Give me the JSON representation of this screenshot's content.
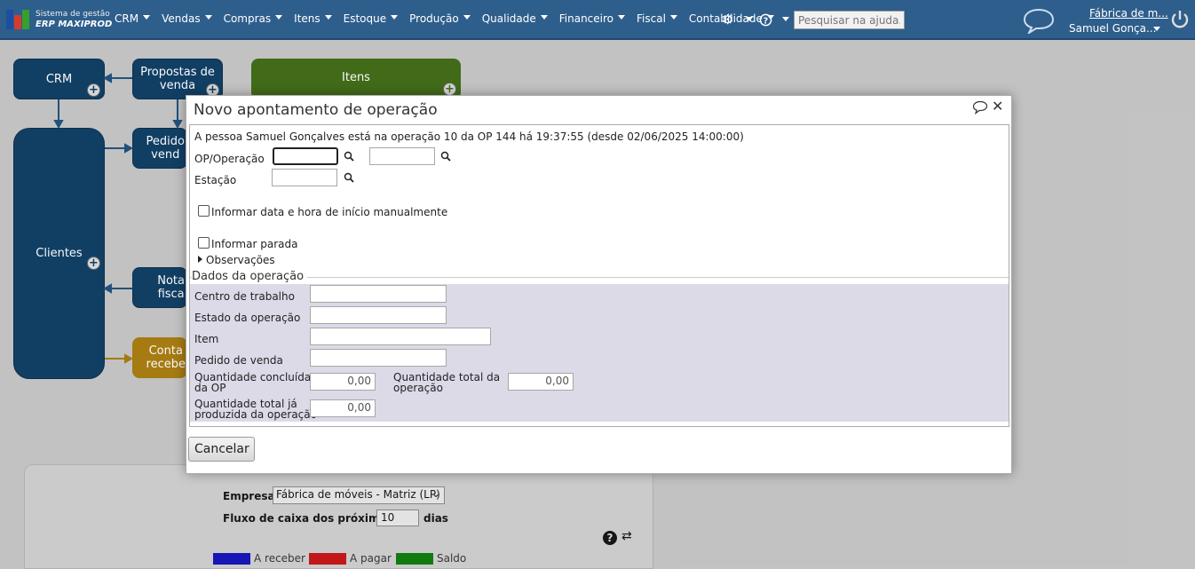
{
  "header": {
    "logo_line1": "Sistema de gestão",
    "logo_line2": "ERP MAXIPROD",
    "menu": [
      "CRM",
      "Vendas",
      "Compras",
      "Itens",
      "Estoque",
      "Produção",
      "Qualidade",
      "Financeiro",
      "Fiscal",
      "Contabilidade"
    ],
    "help_placeholder": "Pesquisar na ajuda...",
    "company": "Fábrica de m...",
    "user": "Samuel Gonça..."
  },
  "flow": {
    "crm": "CRM",
    "propostas": "Propostas de venda",
    "itens": "Itens",
    "pedidos": "Pedido\nvend",
    "clientes": "Clientes",
    "notas": "Nota\nfisca",
    "contas": "Conta\nrecebe"
  },
  "cashflow": {
    "empresa_label": "Empresa",
    "empresa_value": "Fábrica de móveis - Matriz (LP)",
    "fluxo_label": "Fluxo de caixa dos próximos",
    "fluxo_value": "10",
    "fluxo_unit": "dias",
    "legend": [
      {
        "label": "A receber",
        "color": "#1010b8"
      },
      {
        "label": "A pagar",
        "color": "#c41414"
      },
      {
        "label": "Saldo",
        "color": "#0b7a0b"
      }
    ]
  },
  "modal": {
    "title": "Novo apontamento de operação",
    "info": "A pessoa Samuel Gonçalves está na operação 10 da OP 144 há 19:37:55 (desde 02/06/2025 14:00:00)",
    "op_label": "OP/Operação",
    "estacao_label": "Estação",
    "manual_label": "Informar data e hora de início manualmente",
    "parada_label": "Informar parada",
    "obs_label": "Observações",
    "section_title": "Dados da operação",
    "centro_label": "Centro de trabalho",
    "estado_label": "Estado da operação",
    "item_label": "Item",
    "pedido_label": "Pedido de venda",
    "qtd_concluida_label_1": "Quantidade concluída",
    "qtd_concluida_label_2": "da OP",
    "qtd_concluida_value": "0,00",
    "qtd_total_label_1": "Quantidade total da",
    "qtd_total_label_2": "operação",
    "qtd_total_value": "0,00",
    "qtd_produzida_label_1": "Quantidade total já",
    "qtd_produzida_label_2": "produzida da operação",
    "qtd_produzida_value": "0,00",
    "cancel_label": "Cancelar"
  }
}
